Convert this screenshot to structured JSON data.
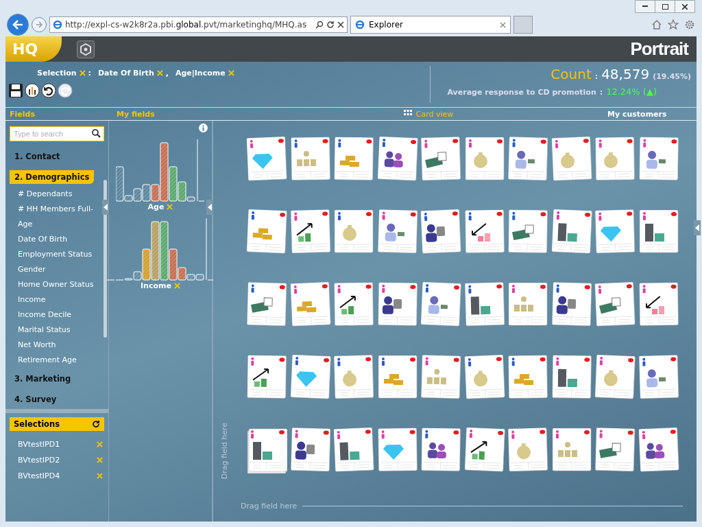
{
  "browser": {
    "url_start": "http://expl-cs-w2k8r2a.pbi.",
    "url_bold": "global",
    "url_end": ".pvt/marketinghq/MHQ.as",
    "tab_title": "Explorer"
  },
  "app": {
    "logo": "HQ",
    "brand": "Portrait"
  },
  "selection": {
    "label": "Selection",
    "separator": ":",
    "filters": [
      {
        "label": "Date Of Birth",
        "suffix": ","
      },
      {
        "label": "Age|Income"
      }
    ]
  },
  "count": {
    "label": "Count",
    "separator": ":",
    "value": "48,579",
    "share": "(19.45%)"
  },
  "response": {
    "label": "Average response to CD promotion",
    "separator": ":",
    "value": "12.24% (▲)"
  },
  "headers": {
    "fields": "Fields",
    "my_fields": "My fields",
    "card_view": "Card view",
    "my_customers": "My customers"
  },
  "search": {
    "placeholder": "Type to search"
  },
  "groups": [
    {
      "label": "1. Contact",
      "expanded": false
    },
    {
      "label": "2. Demographics",
      "expanded": true,
      "children": [
        "# Dependants",
        "# HH Members Full-",
        "Age",
        "Date Of Birth",
        "Employment Status",
        "Gender",
        "Home Owner Status",
        "Income",
        "Income Decile",
        "Marital Status",
        "Net Worth",
        "Retirement Age"
      ]
    },
    {
      "label": "3. Marketing",
      "expanded": false
    },
    {
      "label": "4. Survey",
      "expanded": false
    }
  ],
  "selections": {
    "title": "Selections",
    "items": [
      "BVtestIPD1",
      "BVtestIPD2",
      "BVtestIPD4"
    ]
  },
  "my_fields": [
    {
      "label": "Age",
      "kind": "age"
    },
    {
      "label": "Income",
      "kind": "income"
    }
  ],
  "drop_hints": {
    "vertical": "Drag field here",
    "horizontal": "Drag field here"
  },
  "cards": [
    {
      "color": "#e040a0",
      "kind": "diamond"
    },
    {
      "color": "#2a5cc8",
      "kind": "hierarchy"
    },
    {
      "color": "#2a5cc8",
      "kind": "gold"
    },
    {
      "color": "#2a5cc8",
      "kind": "couple"
    },
    {
      "color": "#e040a0",
      "kind": "cash"
    },
    {
      "color": "#e040a0",
      "kind": "moneybag"
    },
    {
      "color": "#2a5cc8",
      "kind": "worker"
    },
    {
      "color": "#e040a0",
      "kind": "moneybag"
    },
    {
      "color": "#e040a0",
      "kind": "moneybag"
    },
    {
      "color": "#e040a0",
      "kind": "worker"
    },
    {
      "color": "#2a5cc8",
      "kind": "gold"
    },
    {
      "color": "#e040a0",
      "kind": "up"
    },
    {
      "color": "#2a5cc8",
      "kind": "moneybag"
    },
    {
      "color": "#e040a0",
      "kind": "worker"
    },
    {
      "color": "#2a5cc8",
      "kind": "banker"
    },
    {
      "color": "#2a5cc8",
      "kind": "down"
    },
    {
      "color": "#2a5cc8",
      "kind": "cash"
    },
    {
      "color": "#e040a0",
      "kind": "building"
    },
    {
      "color": "#e040a0",
      "kind": "diamond"
    },
    {
      "color": "#e040a0",
      "kind": "building"
    },
    {
      "color": "#2a5cc8",
      "kind": "cash"
    },
    {
      "color": "#e040a0",
      "kind": "gold"
    },
    {
      "color": "#e040a0",
      "kind": "up"
    },
    {
      "color": "#e040a0",
      "kind": "banker"
    },
    {
      "color": "#2a5cc8",
      "kind": "worker"
    },
    {
      "color": "#2a5cc8",
      "kind": "building"
    },
    {
      "color": "#e040a0",
      "kind": "hierarchy"
    },
    {
      "color": "#2a5cc8",
      "kind": "banker"
    },
    {
      "color": "#e040a0",
      "kind": "cash"
    },
    {
      "color": "#e040a0",
      "kind": "down"
    },
    {
      "color": "#e040a0",
      "kind": "up"
    },
    {
      "color": "#2a5cc8",
      "kind": "diamond"
    },
    {
      "color": "#2a5cc8",
      "kind": "moneybag"
    },
    {
      "color": "#2a5cc8",
      "kind": "gold"
    },
    {
      "color": "#e040a0",
      "kind": "hierarchy"
    },
    {
      "color": "#2a5cc8",
      "kind": "moneybag"
    },
    {
      "color": "#2a5cc8",
      "kind": "gold"
    },
    {
      "color": "#e040a0",
      "kind": "building"
    },
    {
      "color": "#e040a0",
      "kind": "moneybag"
    },
    {
      "color": "#2a5cc8",
      "kind": "worker"
    },
    {
      "color": "#e040a0",
      "kind": "building",
      "stacked": true
    },
    {
      "color": "#e040a0",
      "kind": "banker"
    },
    {
      "color": "#e040a0",
      "kind": "building"
    },
    {
      "color": "#e040a0",
      "kind": "diamond"
    },
    {
      "color": "#2a5cc8",
      "kind": "couple"
    },
    {
      "color": "#e040a0",
      "kind": "up"
    },
    {
      "color": "#e040a0",
      "kind": "moneybag"
    },
    {
      "color": "#e040a0",
      "kind": "hierarchy"
    },
    {
      "color": "#e040a0",
      "kind": "cash"
    },
    {
      "color": "#e040a0",
      "kind": "couple"
    }
  ]
}
